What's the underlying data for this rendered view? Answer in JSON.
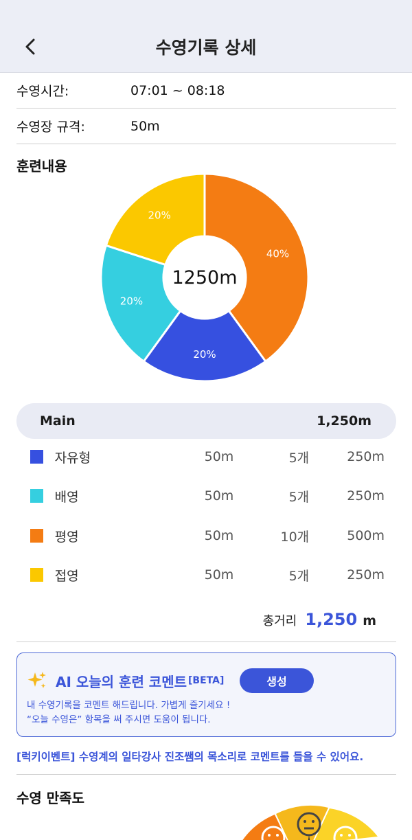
{
  "header": {
    "title": "수영기록 상세"
  },
  "info": {
    "time_label": "수영시간:",
    "time_value": "07:01 ~ 08:18",
    "pool_label": "수영장 규격:",
    "pool_value": "50m"
  },
  "training": {
    "section_title": "훈련내용",
    "center_label": "1250m"
  },
  "chart_data": {
    "type": "pie",
    "title": "",
    "center_label": "1250m",
    "slices": [
      {
        "label": "평영",
        "value": 40,
        "display": "40%",
        "color": "#f47c13"
      },
      {
        "label": "자유형",
        "value": 20,
        "display": "20%",
        "color": "#3650e0"
      },
      {
        "label": "배영",
        "value": 20,
        "display": "20%",
        "color": "#35cfe0"
      },
      {
        "label": "접영",
        "value": 20,
        "display": "20%",
        "color": "#fbc800"
      }
    ]
  },
  "summary": {
    "label": "Main",
    "value": "1,250m"
  },
  "strokes": [
    {
      "name": "자유형",
      "length": "50m",
      "count": "5개",
      "total": "250m",
      "color": "#3650e0"
    },
    {
      "name": "배영",
      "length": "50m",
      "count": "5개",
      "total": "250m",
      "color": "#35cfe0"
    },
    {
      "name": "평영",
      "length": "50m",
      "count": "10개",
      "total": "500m",
      "color": "#f47c13"
    },
    {
      "name": "접영",
      "length": "50m",
      "count": "5개",
      "total": "250m",
      "color": "#fbc800"
    }
  ],
  "total": {
    "label": "총거리",
    "value": "1,250",
    "unit": "m"
  },
  "ai": {
    "icon": "sparkle-icon",
    "title": "AI 오늘의 훈련 코멘트",
    "beta": "[BETA]",
    "button": "생성",
    "desc_line1": "내 수영기록을 코멘트 해드립니다. 가볍게 즐기세요 !",
    "desc_line2": "“오늘 수영은” 항목을 써 주시면 도움이 됩니다."
  },
  "event": {
    "text": "[럭키이벤트] 수영계의 일타강사 진조쌤의 목소리로 코멘트를 들을 수 있어요."
  },
  "satisfaction": {
    "title": "수영 만족도"
  },
  "colors": {
    "accent": "#3b55d9",
    "header_bg": "#eceef6"
  }
}
